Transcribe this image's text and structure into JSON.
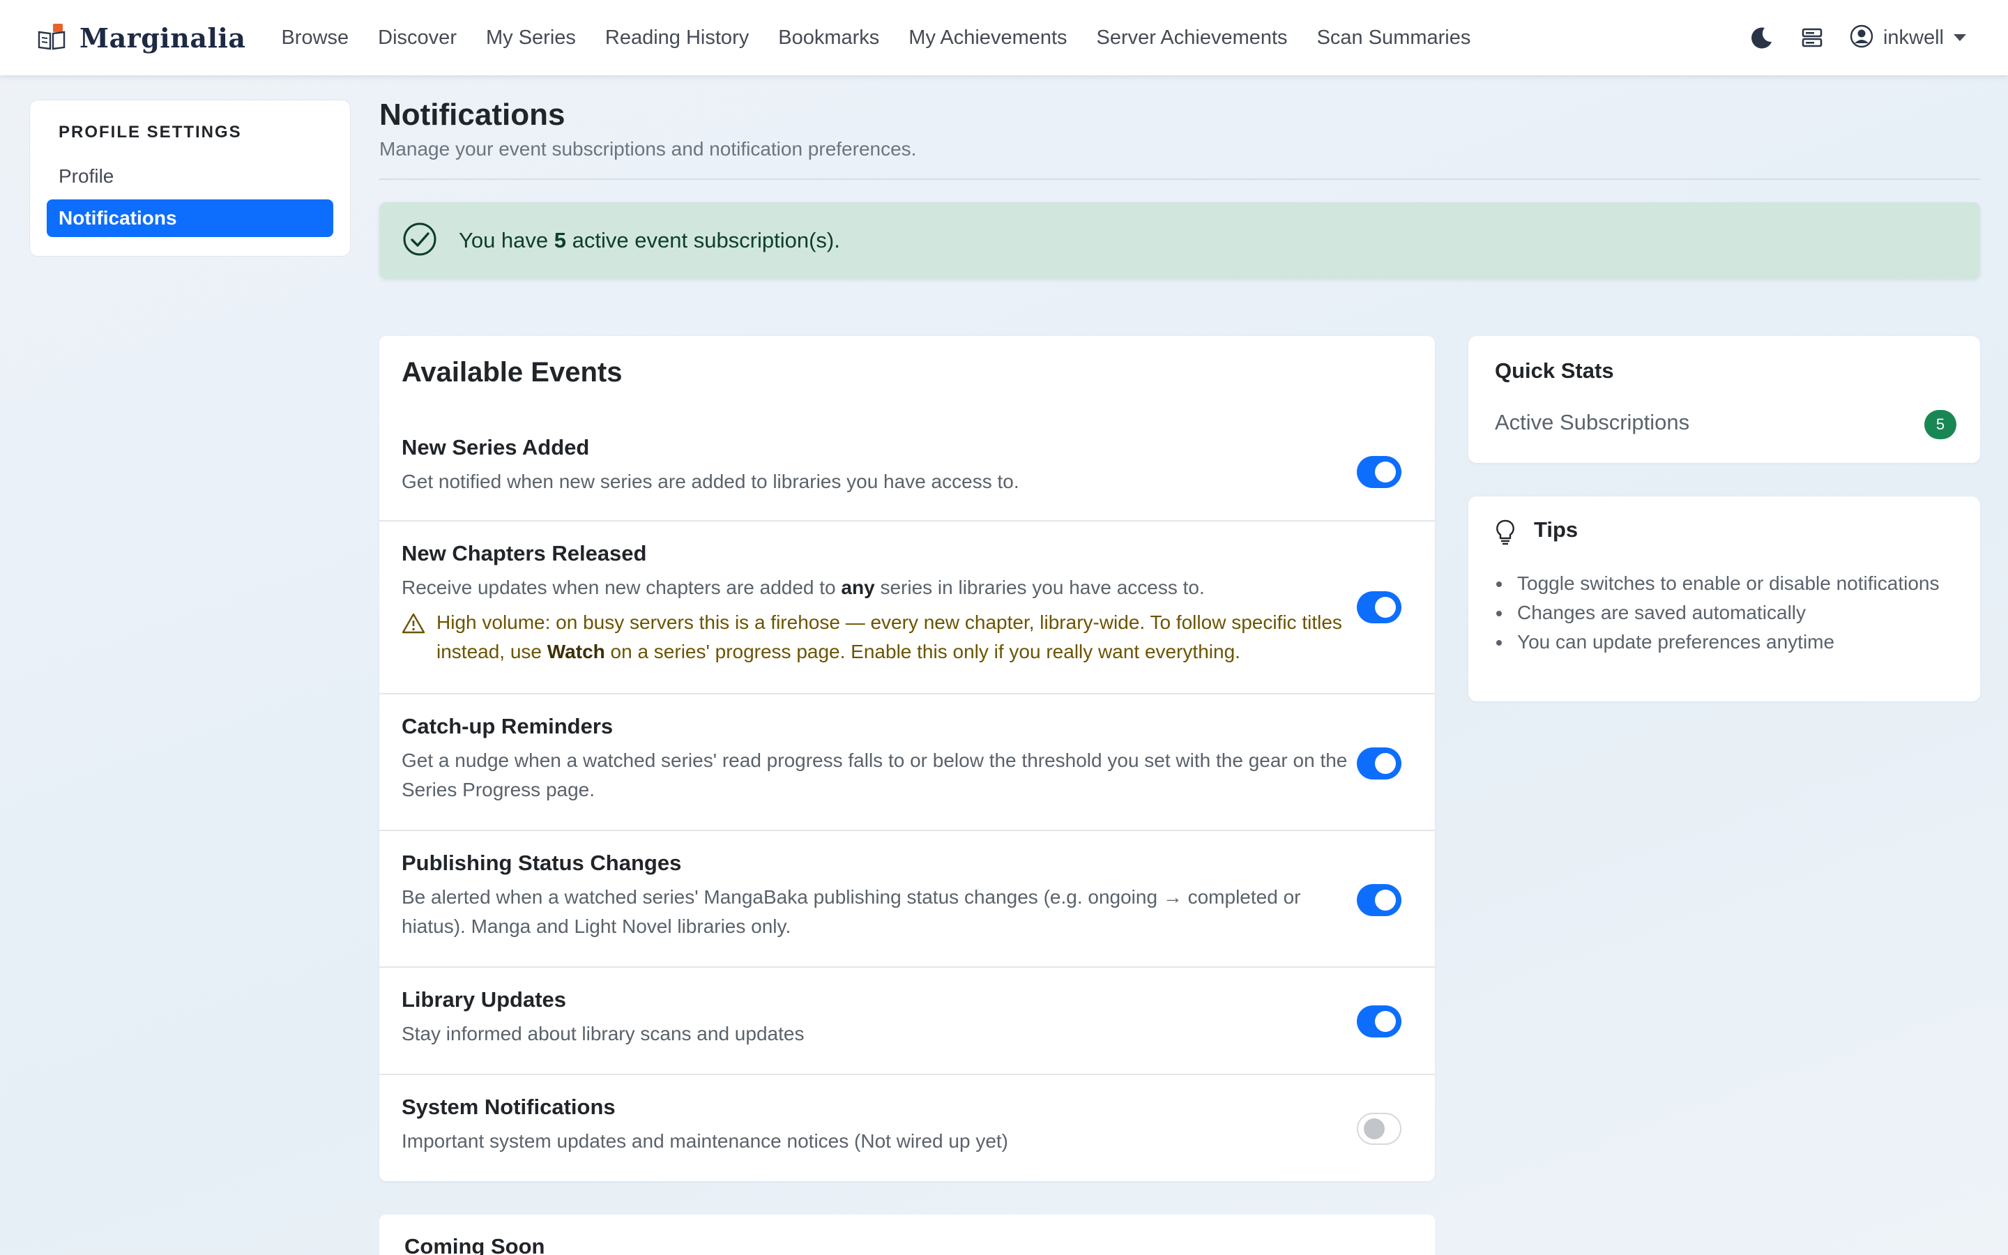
{
  "brand": {
    "name": "Marginalia",
    "logo_icon": "book-icon"
  },
  "nav": {
    "links": [
      "Browse",
      "Discover",
      "My Series",
      "Reading History",
      "Bookmarks",
      "My Achievements",
      "Server Achievements",
      "Scan Summaries"
    ],
    "theme_icon": "moon-icon",
    "server_icon": "server-icon",
    "user_icon": "user-circle-icon",
    "username": "inkwell"
  },
  "sidebar": {
    "title": "PROFILE SETTINGS",
    "items": [
      {
        "label": "Profile",
        "active": false
      },
      {
        "label": "Notifications",
        "active": true
      }
    ]
  },
  "header": {
    "title": "Notifications",
    "subtitle": "Manage your event subscriptions and notification preferences."
  },
  "alert": {
    "prefix": "You have",
    "count": "5",
    "suffix": "active event subscription(s)."
  },
  "events": {
    "title": "Available Events",
    "items": [
      {
        "title": "New Series Added",
        "description": "Get notified when new series are added to libraries you have access to.",
        "enabled": true
      },
      {
        "title": "New Chapters Released",
        "description_prefix": "Receive updates when new chapters are added to",
        "description_bold": "any",
        "description_suffix": "series in libraries you have access to.",
        "warning_prefix": "High volume: on busy servers this is a firehose — every new chapter, library-wide. To follow specific titles instead, use",
        "warning_bold": "Watch",
        "warning_suffix": "on a series' progress page. Enable this only if you really want everything.",
        "enabled": true
      },
      {
        "title": "Catch-up Reminders",
        "description": "Get a nudge when a watched series' read progress falls to or below the threshold you set with the gear on the Series Progress page.",
        "enabled": true
      },
      {
        "title": "Publishing Status Changes",
        "description": "Be alerted when a watched series' MangaBaka publishing status changes (e.g. ongoing → completed or hiatus). Manga and Light Novel libraries only.",
        "enabled": true
      },
      {
        "title": "Library Updates",
        "description": "Stay informed about library scans and updates",
        "enabled": true
      },
      {
        "title": "System Notifications",
        "description": "Important system updates and maintenance notices (Not wired up yet)",
        "enabled": false
      }
    ]
  },
  "coming_soon": {
    "title": "Coming Soon"
  },
  "quick_stats": {
    "title": "Quick Stats",
    "label": "Active Subscriptions",
    "value": "5"
  },
  "tips": {
    "title": "Tips",
    "items": [
      "Toggle switches to enable or disable notifications",
      "Changes are saved automatically",
      "You can update preferences anytime"
    ]
  },
  "colors": {
    "primary": "#0d6efd",
    "success_bg": "#d1e7dd",
    "badge": "#198754",
    "warning_text": "#6b5400"
  }
}
